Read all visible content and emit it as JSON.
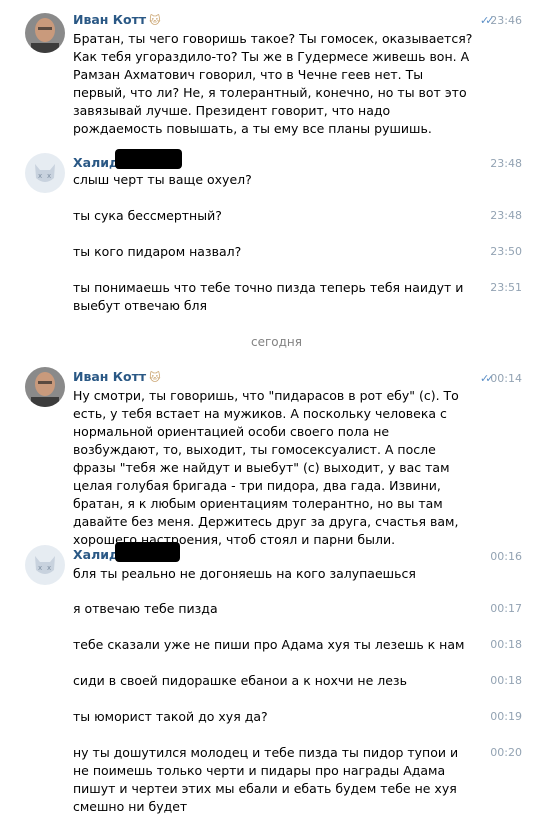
{
  "messages": [
    {
      "author": "Иван Котт",
      "emoji": "🐱",
      "time": "23:46",
      "read": true,
      "text": "Братан, ты чего говоришь такое? Ты гомосек, оказывается? Как тебя угораздило-то? Ты же в Гудермесе живешь вон. А Рамзан Ахматович говорил, что в Чечне геев нет. Ты первый, что ли? Не, я толерантный, конечно, но ты вот это завязывай лучше. Президент говорит, что надо рождаемость повышать, а ты ему все планы рушишь."
    },
    {
      "author": "Халид Г",
      "time": "23:48",
      "text": "слыш черт ты ваще охуел?"
    },
    {
      "time": "23:48",
      "text": "ты сука бессмертный?"
    },
    {
      "time": "23:50",
      "text": "ты кого пидаром назвал?"
    },
    {
      "time": "23:51",
      "text": "ты понимаешь что тебе точно пизда теперь тебя наидут и выебут отвечаю бля"
    },
    {
      "author": "Иван Котт",
      "emoji": "🐱",
      "time": "00:14",
      "read": true,
      "text": "Ну смотри, ты говоришь, что \"пидарасов в рот ебу\" (с). То есть, у тебя встает на мужиков. А поскольку человека с нормальной ориентацией особи своего пола не возбуждают, то, выходит, ты гомосексуалист. А после фразы \"тебя же найдут и выебут\" (с) выходит, у вас там целая голубая бригада - три пидора, два гада. Извини, братан, я к любым ориентациям толерантно, но вы там давайте без меня. Держитесь друг за друга, счастья вам, хорошего настроения, чтоб стоял и парни были."
    },
    {
      "author": "Халид Г",
      "time": "00:16",
      "text": "бля ты реально не догоняешь на кого залупаешься"
    },
    {
      "time": "00:17",
      "text": "я отвечаю тебе пизда"
    },
    {
      "time": "00:18",
      "text": "тебе сказали уже не пиши про Адама хуя ты лезешь к нам"
    },
    {
      "time": "00:18",
      "text": "сиди в своей пидорашке ебанои а к нохчи не лезь"
    },
    {
      "time": "00:19",
      "text": "ты юморист такой до хуя да?"
    },
    {
      "time": "00:20",
      "text": "ну ты дошутился молодец и тебе пизда ты пидор тупои и не поимешь только черти и пидары про награды Адама пишут и чертеи этих мы ебали и ебать будем тебе не хуя смешно ни будет"
    }
  ],
  "separator": "сегодня",
  "read_ticks": "✓✓",
  "colors": {
    "author": "#2a5885",
    "time": "#93a3b3",
    "ticks": "#5c8fc6",
    "separator": "#828282"
  }
}
